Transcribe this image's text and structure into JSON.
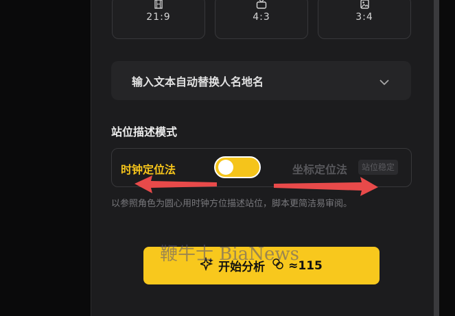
{
  "ratios": [
    {
      "label": "21:9",
      "icon": "film-icon"
    },
    {
      "label": "4:3",
      "icon": "tv-icon"
    },
    {
      "label": "3:4",
      "icon": "image-icon"
    }
  ],
  "dropdown": {
    "label": "输入文本自动替换人名地名",
    "icon": "chevron-down-icon"
  },
  "position_mode": {
    "title": "站位描述模式",
    "left_option": "时钟定位法",
    "right_option": "坐标定位法",
    "right_badge": "站位稳定",
    "toggle_state": "clock",
    "hint": "以参照角色为圆心用时钟方位描述站位，脚本更简洁易审阅。"
  },
  "action": {
    "label": "开始分析",
    "cost": "≈115"
  },
  "watermark": "鞭牛士 BiaNews",
  "colors": {
    "accent": "#f5c41b",
    "panel": "#1c1c1e",
    "annotation_arrow": "#e84a4a"
  }
}
